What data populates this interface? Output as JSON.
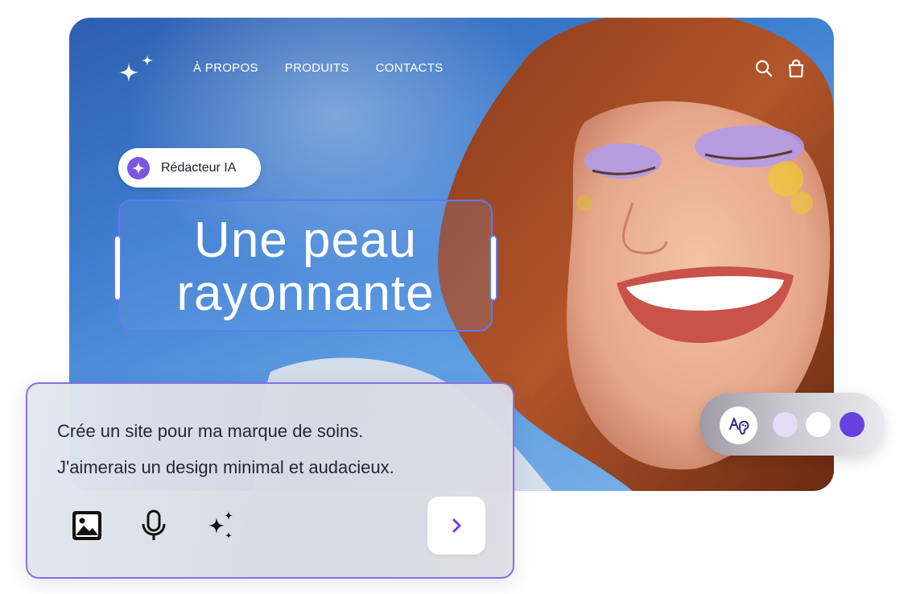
{
  "nav": {
    "items": [
      "À PROPOS",
      "PRODUITS",
      "CONTACTS"
    ],
    "icons": [
      "search-icon",
      "shopping-bag-icon"
    ]
  },
  "badge": {
    "label": "Rédacteur IA",
    "icon": "sparkle-icon"
  },
  "headline": {
    "line1": "Une peau",
    "line2": "rayonnante"
  },
  "prompt": {
    "line1": "Crée un site pour ma marque de soins.",
    "line2": "J'aimerais un design minimal et audacieux.",
    "tools": [
      "image-icon",
      "microphone-icon",
      "sparkles-icon"
    ],
    "send_icon": "chevron-right-icon"
  },
  "palette": {
    "icon": "font-palette-icon",
    "swatches": [
      "#e3ddf7",
      "#ffffff",
      "#6a3fe0"
    ]
  },
  "colors": {
    "accent": "#6a3fe0",
    "selection": "#5e7bf0",
    "sky": "#3f7fd0"
  }
}
